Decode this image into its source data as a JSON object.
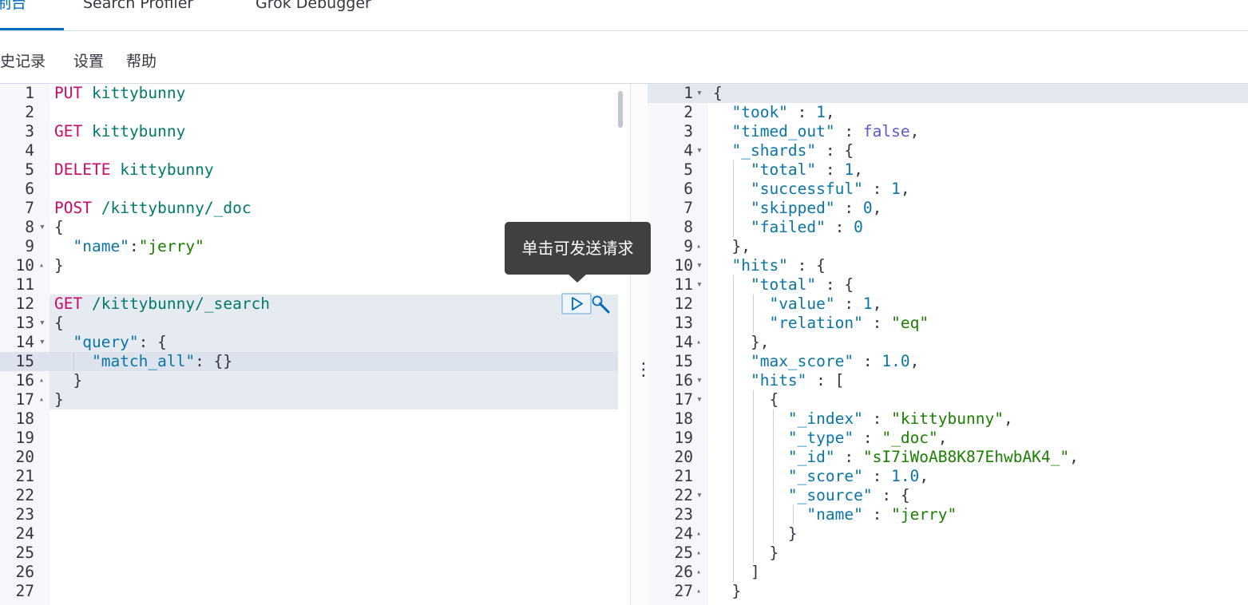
{
  "tabs": [
    {
      "label": "控制台",
      "active": true
    },
    {
      "label": "Search Profiler",
      "active": false
    },
    {
      "label": "Grok Debugger",
      "active": false
    }
  ],
  "menu": [
    "历史记录",
    "设置",
    "帮助"
  ],
  "tooltip": "单击可发送请求",
  "request_editor": {
    "lines": [
      [
        [
          "kw",
          "PUT"
        ],
        [
          "t",
          " "
        ],
        [
          "path",
          "kittybunny"
        ]
      ],
      [],
      [
        [
          "kw",
          "GET"
        ],
        [
          "t",
          " "
        ],
        [
          "path",
          "kittybunny"
        ]
      ],
      [],
      [
        [
          "kw",
          "DELETE"
        ],
        [
          "t",
          " "
        ],
        [
          "path",
          "kittybunny"
        ]
      ],
      [],
      [
        [
          "kw",
          "POST"
        ],
        [
          "t",
          " "
        ],
        [
          "path",
          "/kittybunny/_doc"
        ]
      ],
      [
        [
          "t",
          "{"
        ]
      ],
      [
        [
          "t",
          "  "
        ],
        [
          "key",
          "\"name\""
        ],
        [
          "t",
          ":"
        ],
        [
          "str",
          "\"jerry\""
        ]
      ],
      [
        [
          "t",
          "}"
        ]
      ],
      [],
      [
        [
          "kw",
          "GET"
        ],
        [
          "t",
          " "
        ],
        [
          "path",
          "/kittybunny/_search"
        ]
      ],
      [
        [
          "t",
          "{"
        ]
      ],
      [
        [
          "t",
          "  "
        ],
        [
          "key",
          "\"query\""
        ],
        [
          "t",
          ": {"
        ]
      ],
      [
        [
          "t",
          "    "
        ],
        [
          "key",
          "\"match_all\""
        ],
        [
          "t",
          ": {}"
        ]
      ],
      [
        [
          "t",
          "  }"
        ]
      ],
      [
        [
          "t",
          "}"
        ]
      ],
      [],
      [],
      [],
      [],
      [],
      [],
      [],
      [],
      [],
      []
    ],
    "folds": {
      "8": "open",
      "10": "close",
      "13": "open",
      "14": "open",
      "16": "close",
      "17": "close"
    },
    "cursor_line": 15
  },
  "response_editor": {
    "lines": [
      [
        [
          "t",
          "{"
        ]
      ],
      [
        [
          "t",
          "  "
        ],
        [
          "key",
          "\"took\""
        ],
        [
          "t",
          " : "
        ],
        [
          "num",
          "1"
        ],
        [
          "t",
          ","
        ]
      ],
      [
        [
          "t",
          "  "
        ],
        [
          "key",
          "\"timed_out\""
        ],
        [
          "t",
          " : "
        ],
        [
          "bool",
          "false"
        ],
        [
          "t",
          ","
        ]
      ],
      [
        [
          "t",
          "  "
        ],
        [
          "key",
          "\"_shards\""
        ],
        [
          "t",
          " : {"
        ]
      ],
      [
        [
          "t",
          "    "
        ],
        [
          "key",
          "\"total\""
        ],
        [
          "t",
          " : "
        ],
        [
          "num",
          "1"
        ],
        [
          "t",
          ","
        ]
      ],
      [
        [
          "t",
          "    "
        ],
        [
          "key",
          "\"successful\""
        ],
        [
          "t",
          " : "
        ],
        [
          "num",
          "1"
        ],
        [
          "t",
          ","
        ]
      ],
      [
        [
          "t",
          "    "
        ],
        [
          "key",
          "\"skipped\""
        ],
        [
          "t",
          " : "
        ],
        [
          "num",
          "0"
        ],
        [
          "t",
          ","
        ]
      ],
      [
        [
          "t",
          "    "
        ],
        [
          "key",
          "\"failed\""
        ],
        [
          "t",
          " : "
        ],
        [
          "num",
          "0"
        ]
      ],
      [
        [
          "t",
          "  },"
        ]
      ],
      [
        [
          "t",
          "  "
        ],
        [
          "key",
          "\"hits\""
        ],
        [
          "t",
          " : {"
        ]
      ],
      [
        [
          "t",
          "    "
        ],
        [
          "key",
          "\"total\""
        ],
        [
          "t",
          " : {"
        ]
      ],
      [
        [
          "t",
          "      "
        ],
        [
          "key",
          "\"value\""
        ],
        [
          "t",
          " : "
        ],
        [
          "num",
          "1"
        ],
        [
          "t",
          ","
        ]
      ],
      [
        [
          "t",
          "      "
        ],
        [
          "key",
          "\"relation\""
        ],
        [
          "t",
          " : "
        ],
        [
          "str",
          "\"eq\""
        ]
      ],
      [
        [
          "t",
          "    },"
        ]
      ],
      [
        [
          "t",
          "    "
        ],
        [
          "key",
          "\"max_score\""
        ],
        [
          "t",
          " : "
        ],
        [
          "num",
          "1.0"
        ],
        [
          "t",
          ","
        ]
      ],
      [
        [
          "t",
          "    "
        ],
        [
          "key",
          "\"hits\""
        ],
        [
          "t",
          " : ["
        ]
      ],
      [
        [
          "t",
          "      {"
        ]
      ],
      [
        [
          "t",
          "        "
        ],
        [
          "key",
          "\"_index\""
        ],
        [
          "t",
          " : "
        ],
        [
          "str",
          "\"kittybunny\""
        ],
        [
          "t",
          ","
        ]
      ],
      [
        [
          "t",
          "        "
        ],
        [
          "key",
          "\"_type\""
        ],
        [
          "t",
          " : "
        ],
        [
          "str",
          "\"_doc\""
        ],
        [
          "t",
          ","
        ]
      ],
      [
        [
          "t",
          "        "
        ],
        [
          "key",
          "\"_id\""
        ],
        [
          "t",
          " : "
        ],
        [
          "str",
          "\"sI7iWoAB8K87EhwbAK4_\""
        ],
        [
          "t",
          ","
        ]
      ],
      [
        [
          "t",
          "        "
        ],
        [
          "key",
          "\"_score\""
        ],
        [
          "t",
          " : "
        ],
        [
          "num",
          "1.0"
        ],
        [
          "t",
          ","
        ]
      ],
      [
        [
          "t",
          "        "
        ],
        [
          "key",
          "\"_source\""
        ],
        [
          "t",
          " : {"
        ]
      ],
      [
        [
          "t",
          "          "
        ],
        [
          "key",
          "\"name\""
        ],
        [
          "t",
          " : "
        ],
        [
          "str",
          "\"jerry\""
        ]
      ],
      [
        [
          "t",
          "        }"
        ]
      ],
      [
        [
          "t",
          "      }"
        ]
      ],
      [
        [
          "t",
          "    ]"
        ]
      ],
      [
        [
          "t",
          "  }"
        ]
      ]
    ],
    "folds": {
      "1": "open",
      "4": "open",
      "9": "close",
      "10": "open",
      "11": "open",
      "14": "close",
      "16": "open",
      "17": "open",
      "22": "open",
      "24": "close",
      "25": "close",
      "26": "close",
      "27": "close"
    }
  }
}
